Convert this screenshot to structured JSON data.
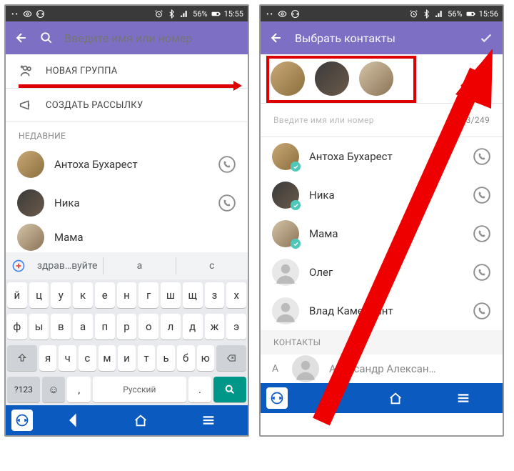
{
  "status": {
    "battery": "56%",
    "time_left": "15:55",
    "time_right": "15:56"
  },
  "left": {
    "search_placeholder": "Введите имя или номер",
    "new_group": "НОВАЯ ГРУППА",
    "new_broadcast": "СОЗДАТЬ РАССЫЛКУ",
    "recent_hdr": "НЕДАВНИЕ",
    "contacts": [
      {
        "name": "Антоха Бухарест"
      },
      {
        "name": "Ника"
      },
      {
        "name": "Мама"
      }
    ],
    "keyboard": {
      "suggestions": [
        "здрав…вуйте",
        "а",
        "с"
      ],
      "row1": [
        "й",
        "ц",
        "у",
        "к",
        "е",
        "н",
        "г",
        "ш",
        "щ",
        "з",
        "х"
      ],
      "row2": [
        "ф",
        "ы",
        "в",
        "а",
        "п",
        "р",
        "о",
        "л",
        "д",
        "ж",
        "э"
      ],
      "row3": [
        "я",
        "ч",
        "с",
        "м",
        "и",
        "т",
        "ь",
        "б",
        "ю"
      ],
      "symbol": "?123",
      "space": "Русский"
    }
  },
  "right": {
    "title": "Выбрать контакты",
    "input_placeholder": "Введите имя или номер",
    "counter": "3/249",
    "contacts": [
      {
        "name": "Антоха Бухарест",
        "selected": true
      },
      {
        "name": "Ника",
        "selected": true
      },
      {
        "name": "Мама",
        "selected": true
      },
      {
        "name": "Олег",
        "selected": false,
        "placeholder": true
      },
      {
        "name": "Влад Камендант",
        "selected": false,
        "placeholder": true
      }
    ],
    "section2": "КОНТАКТЫ",
    "letter": "А",
    "more": "Александр Алексан…"
  }
}
